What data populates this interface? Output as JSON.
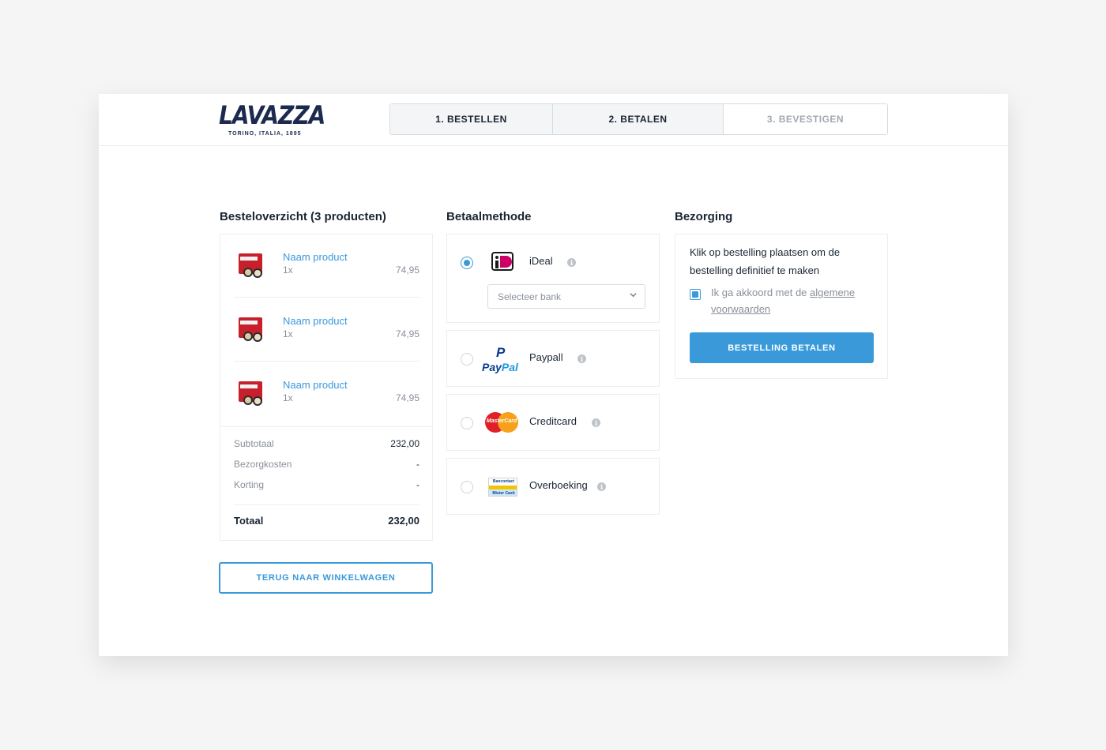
{
  "brand": {
    "logo_text": "LAVAZZA",
    "logo_sub": "TORINO, ITALIA, 1895"
  },
  "steps": [
    {
      "label": "1. BESTELLEN"
    },
    {
      "label": "2. BETALEN"
    },
    {
      "label": "3. BEVESTIGEN"
    }
  ],
  "order": {
    "title": "Besteloverzicht (3 producten)",
    "items": [
      {
        "name": "Naam product",
        "qty": "1x",
        "price": "74,95"
      },
      {
        "name": "Naam product",
        "qty": "1x",
        "price": "74,95"
      },
      {
        "name": "Naam product",
        "qty": "1x",
        "price": "74,95"
      }
    ],
    "subtotal_label": "Subtotaal",
    "subtotal_value": "232,00",
    "shipping_label": "Bezorgkosten",
    "shipping_value": "-",
    "discount_label": "Korting",
    "discount_value": "-",
    "total_label": "Totaal",
    "total_value": "232,00",
    "back_button": "TERUG NAAR WINKELWAGEN"
  },
  "payment": {
    "title": "Betaalmethode",
    "methods": [
      {
        "label": "iDeal",
        "icon": "ideal-logo",
        "selected": true
      },
      {
        "label": "Paypall",
        "icon": "paypal-logo",
        "selected": false
      },
      {
        "label": "Creditcard",
        "icon": "mastercard-logo",
        "selected": false
      },
      {
        "label": "Overboeking",
        "icon": "bancontact-logo",
        "selected": false
      }
    ],
    "bank_select_placeholder": "Selecteer bank",
    "paypal_mark": "P",
    "paypal_word_1": "Pay",
    "paypal_word_2": "Pal",
    "mastercard_text": "MasterCard",
    "bancontact_top": "Bancontact",
    "bancontact_bottom": "Mister Cash",
    "info_glyph": "i"
  },
  "delivery": {
    "title": "Bezorging",
    "instruction": "Klik op bestelling plaatsen om de bestelling definitief te maken",
    "agree_prefix": "Ik ga akkoord met de",
    "agree_link": "algemene voorwaarden",
    "terms_checked": true,
    "pay_button": "BESTELLING BETALEN"
  },
  "colors": {
    "accent": "#3a9ad9",
    "text": "#1a2533",
    "muted": "#8a9099",
    "brand_navy": "#1b2a4e"
  }
}
